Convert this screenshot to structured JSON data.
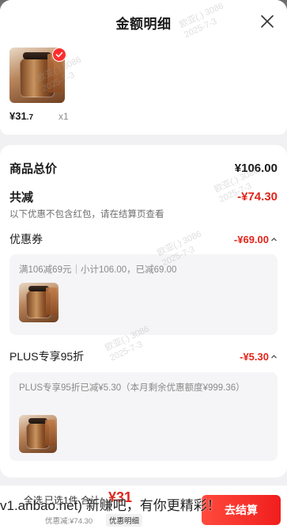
{
  "header": {
    "title": "金额明细"
  },
  "product": {
    "price_int": "¥31",
    "price_dec": ".7",
    "qty": "x1"
  },
  "summary": {
    "total_label": "商品总价",
    "total_value": "¥106.00",
    "discount_label": "共减",
    "discount_value": "-¥74.30",
    "discount_note": "以下优惠不包含红包，请在结算页查看"
  },
  "coupon": {
    "label": "优惠券",
    "value": "-¥69.00",
    "detail": "满106减69元｜小计106.00，已减69.00"
  },
  "plus": {
    "label": "PLUS专享95折",
    "value": "-¥5.30",
    "detail": "PLUS专享95折已减¥5.30（本月剩余优惠额度¥999.36）"
  },
  "bottom_bar": {
    "select_all": "全选",
    "selected_prefix": "已选1件 合计：",
    "total": "¥31",
    "discount_text": "优惠减:¥74.30",
    "detail_link": "优惠明细",
    "cta": "去结算"
  },
  "overlay": {
    "text": "v1.anbao.net) 新赚吧，有你更精彩！"
  },
  "watermark": {
    "line1": "欧亚(.) 3086",
    "line2": "2025-7-3"
  },
  "colors": {
    "accent": "#e1251b",
    "cta": "#f01e1e"
  },
  "icons": [
    "close-icon",
    "check-icon",
    "chevron-up-icon"
  ]
}
